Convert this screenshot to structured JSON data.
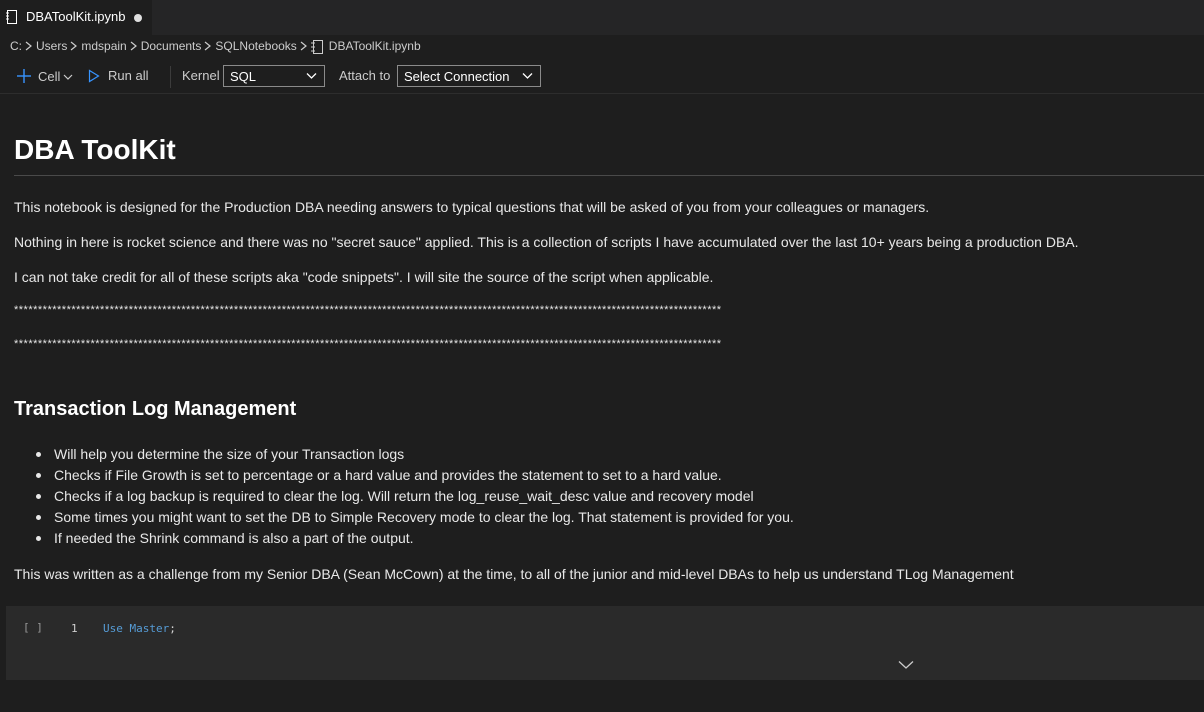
{
  "tab": {
    "title": "DBAToolKit.ipynb",
    "unsaved_indicator": "modified-dot"
  },
  "breadcrumb": [
    "C:",
    "Users",
    "mdspain",
    "Documents",
    "SQLNotebooks",
    "DBAToolKit.ipynb"
  ],
  "toolbar": {
    "cell_label": "Cell",
    "run_all_label": "Run all",
    "kernel_label": "Kernel",
    "kernel_value": "SQL",
    "attach_label": "Attach to",
    "attach_value": "Select Connection"
  },
  "notebook": {
    "title": "DBA ToolKit",
    "intro": [
      "This notebook is designed for the Production DBA needing answers to typical questions that will be asked of you from your colleagues or managers.",
      "Nothing in here is rocket science and there was no \"secret sauce\" applied.  This is a collection of scripts I have accumulated over the last 10+ years being a production DBA.",
      "I can not take credit for all of these scripts aka \"code snippets\".  I will site the source of the script when applicable."
    ],
    "separator_1": "****************************************************************************************************************************************************",
    "separator_2": "****************************************************************************************************************************************************",
    "section_title": "Transaction Log Management",
    "bullets": [
      "Will help you determine the size of your Transaction logs",
      "Checks if File Growth is set to percentage or a hard value and provides the statement to set to a hard value.",
      "Checks if a log backup is required to clear the log.  Will return the log_reuse_wait_desc value and recovery model",
      "Some times you might want to set the DB to Simple Recovery mode to clear the log.  That statement is provided for you.",
      "If needed the Shrink command is also a part of the output."
    ],
    "footer_para": "This was written as a challenge from my Senior DBA (Sean McCown) at the time, to all of the junior and mid-level DBAs to help us understand TLog Management",
    "code_cell": {
      "exec_count": "[ ]",
      "line_number": "1",
      "code_keyword": "Use Master",
      "code_punct": ";"
    }
  },
  "colors": {
    "accent": "#3794ff",
    "keyword": "#569cd6",
    "background": "#1e1e1e"
  }
}
